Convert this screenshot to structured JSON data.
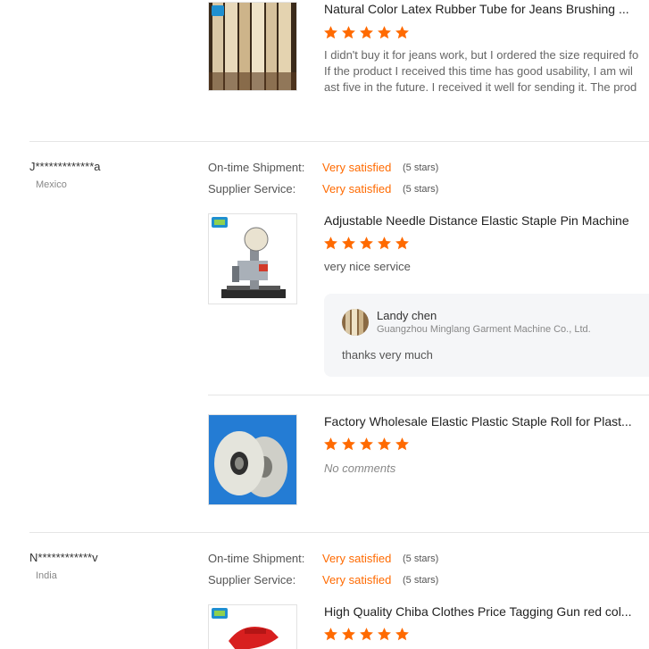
{
  "colors": {
    "star": "#ff6a00",
    "satisfied": "#ff6a00",
    "divider": "#e5e5e5",
    "reply_bg": "#f5f6f8"
  },
  "reviews": [
    {
      "items": [
        {
          "title": "Natural Color Latex Rubber Tube for Jeans Brushing ...",
          "rating": 5,
          "comment_lines": [
            "I didn't buy it for jeans work, but I ordered the size required fo",
            "If the product I received this time has good usability, I am wil",
            "ast five in the future. I received it well for sending it. The prod"
          ]
        }
      ]
    },
    {
      "buyer": "J*************a",
      "country": "Mexico",
      "metrics": [
        {
          "label": "On-time Shipment:",
          "value": "Very satisfied",
          "stars": "(5 stars)"
        },
        {
          "label": "Supplier Service:",
          "value": "Very satisfied",
          "stars": "(5 stars)"
        }
      ],
      "items": [
        {
          "title": "Adjustable Needle Distance Elastic Staple Pin Machine",
          "rating": 5,
          "comment": "very  nice  service",
          "reply": {
            "name": "Landy chen",
            "company": "Guangzhou Minglang Garment Machine Co., Ltd.",
            "text": "thanks very much"
          }
        },
        {
          "title": "Factory Wholesale Elastic Plastic Staple Roll for Plast...",
          "rating": 5,
          "comment": "No comments"
        }
      ]
    },
    {
      "buyer": "N************v",
      "country": "India",
      "metrics": [
        {
          "label": "On-time Shipment:",
          "value": "Very satisfied",
          "stars": "(5 stars)"
        },
        {
          "label": "Supplier Service:",
          "value": "Very satisfied",
          "stars": "(5 stars)"
        }
      ],
      "items": [
        {
          "title": "High Quality Chiba Clothes Price Tagging Gun red col...",
          "rating": 5
        }
      ]
    }
  ]
}
